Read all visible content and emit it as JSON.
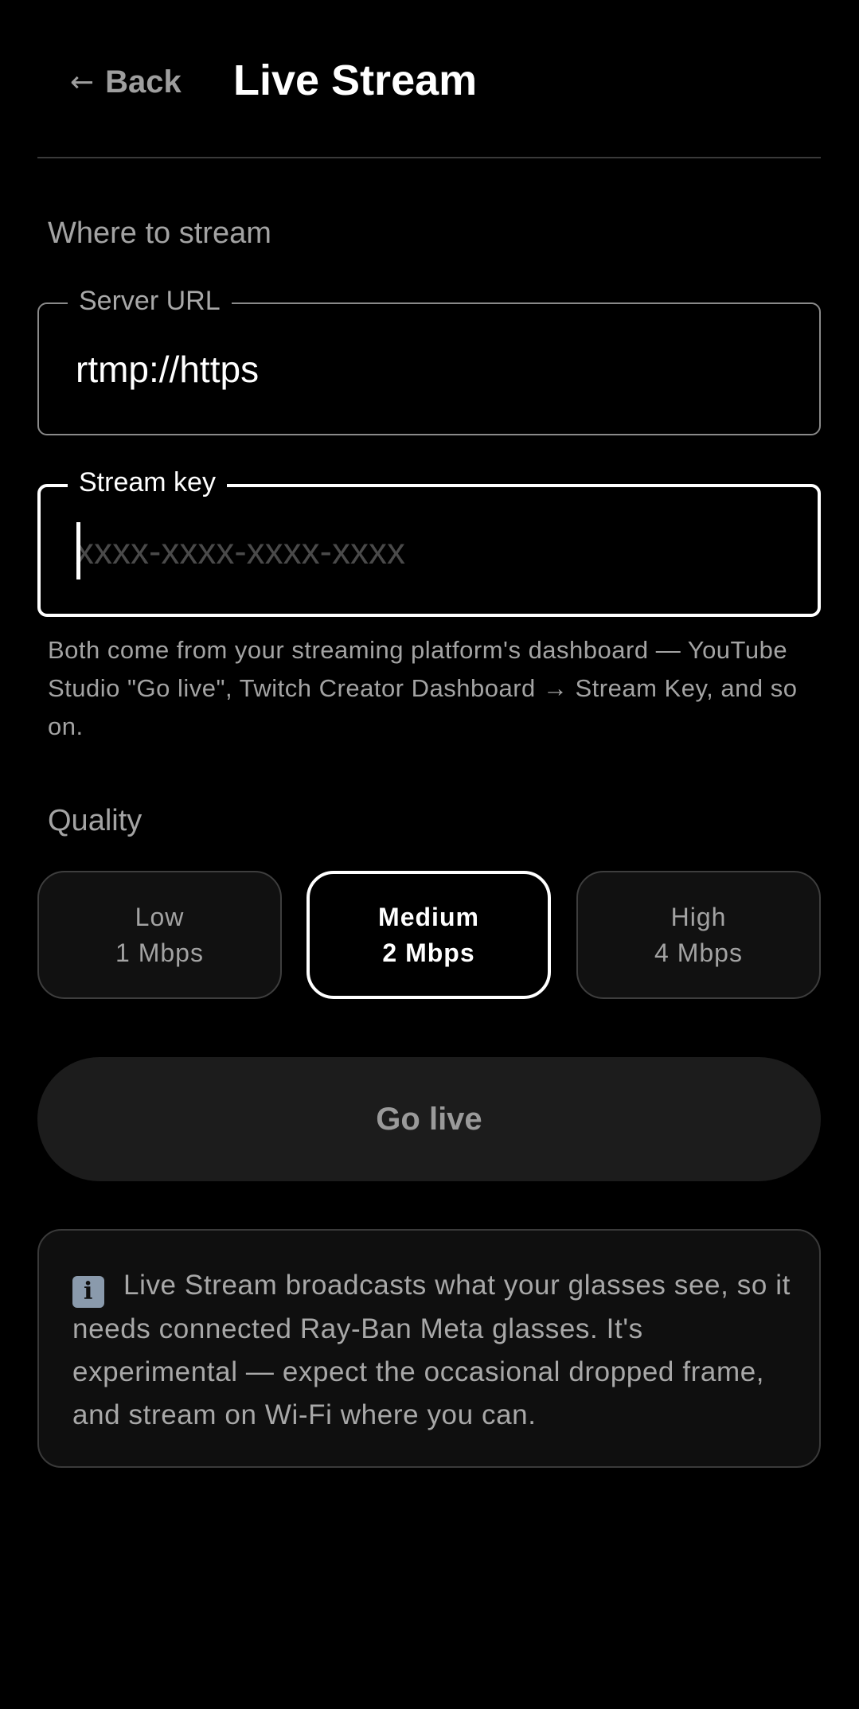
{
  "header": {
    "back_arrow": "←",
    "back_label": "Back",
    "title": "Live Stream"
  },
  "where_section": {
    "label": "Where to stream"
  },
  "server_url": {
    "label": "Server URL",
    "value": "rtmp://https"
  },
  "stream_key": {
    "label": "Stream key",
    "value": "",
    "placeholder": "xxxx-xxxx-xxxx-xxxx",
    "focused": true
  },
  "helper_text": "Both come from your streaming platform's dashboard — YouTube Studio \"Go live\", Twitch Creator Dashboard → Stream Key, and so on.",
  "quality_section": {
    "label": "Quality",
    "options": [
      {
        "name": "Low",
        "rate": "1 Mbps",
        "selected": false
      },
      {
        "name": "Medium",
        "rate": "2 Mbps",
        "selected": true
      },
      {
        "name": "High",
        "rate": "4 Mbps",
        "selected": false
      }
    ]
  },
  "go_live_button": {
    "label": "Go live",
    "enabled": false
  },
  "info": {
    "icon": "info-icon",
    "icon_glyph": "i",
    "text": "Live Stream broadcasts what your glasses see, so it needs connected Ray-Ban Meta glasses. It's experimental — expect the occasional dropped frame, and stream on Wi-Fi where you can."
  },
  "colors": {
    "background": "#000000",
    "accent": "#ffffff",
    "muted_text": "#a3a3a3",
    "button_bg": "#1c1c1c"
  }
}
